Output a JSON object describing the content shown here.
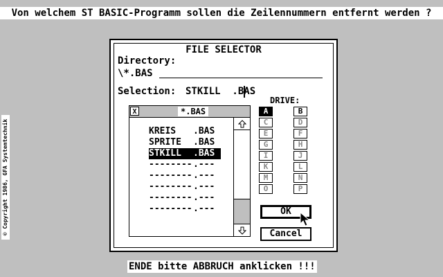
{
  "prompt": "Von welchem ST BASIC-Programm sollen die Zeilennummern entfernt werden ?",
  "footer": "ENDE bitte ABBRUCH anklicken !!!",
  "copyright": "© Copyright 1986, GFA Systemtechnik",
  "dialog": {
    "title": "FILE SELECTOR",
    "directory_label": "Directory:",
    "directory_value": "\\*.BAS",
    "selection_label": "Selection:",
    "selection_value": "STKILL  .BAS",
    "drive_label": "DRIVE:",
    "drives_left": [
      "A",
      "C",
      "E",
      "G",
      "I",
      "K",
      "M",
      "O"
    ],
    "drives_right": [
      "B",
      "D",
      "F",
      "H",
      "J",
      "L",
      "N",
      "P"
    ],
    "selected_drive": "A",
    "file_mask": "*.BAS",
    "close_glyph": "X",
    "scroll_up_icon": "up-arrow-icon",
    "scroll_down_icon": "down-arrow-icon",
    "files": [
      {
        "name": "KREIS",
        "ext": ".BAS",
        "selected": false
      },
      {
        "name": "SPRITE",
        "ext": ".BAS",
        "selected": false
      },
      {
        "name": "STKILL",
        "ext": ".BAS",
        "selected": true
      },
      {
        "name": "--------",
        "ext": ".---",
        "selected": false
      },
      {
        "name": "--------",
        "ext": ".---",
        "selected": false
      },
      {
        "name": "--------",
        "ext": ".---",
        "selected": false
      },
      {
        "name": "--------",
        "ext": ".---",
        "selected": false
      },
      {
        "name": "--------",
        "ext": ".---",
        "selected": false
      }
    ],
    "ok_label": "OK",
    "cancel_label": "Cancel"
  }
}
